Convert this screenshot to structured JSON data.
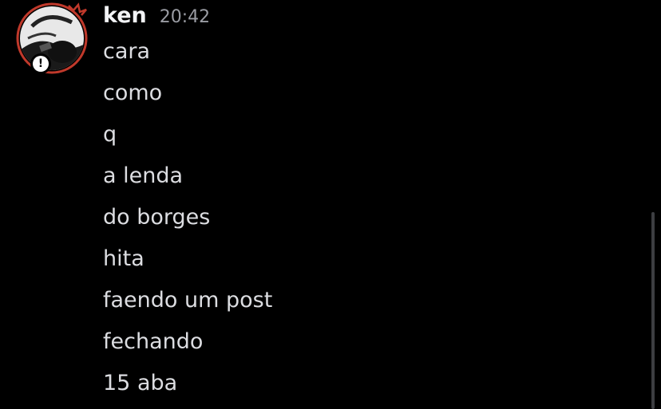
{
  "message_group": {
    "author": "ken",
    "timestamp": "20:42",
    "avatar_icon": "avatar-image",
    "status_icon": "alert-icon",
    "status_glyph": "!",
    "messages": [
      "cara",
      "como",
      "q",
      "a lenda",
      "do borges",
      "hita",
      "faendo um post",
      "fechando",
      "15 aba"
    ]
  },
  "colors": {
    "background": "#000000",
    "username": "#f2f3f5",
    "timestamp": "#9a9ca3",
    "message_text": "#dcdde1",
    "avatar_ring": "#c0392b",
    "scrollbar": "#3d3e42"
  }
}
